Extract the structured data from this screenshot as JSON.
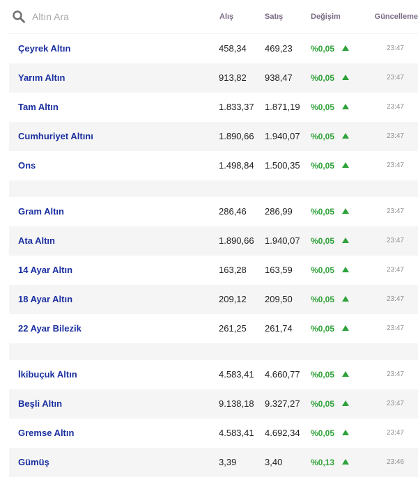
{
  "search": {
    "placeholder": "Altın Ara"
  },
  "columns": {
    "buy": "Alış",
    "sell": "Satış",
    "change": "Değişim",
    "updated": "Güncelleme"
  },
  "colors": {
    "link": "#1a2fa0",
    "up": "#2fa23a",
    "header": "#7b6b84"
  },
  "groups": [
    [
      {
        "name": "Çeyrek Altın",
        "buy": "458,34",
        "sell": "469,23",
        "change": "%0,05",
        "dir": "up",
        "time": "23:47"
      },
      {
        "name": "Yarım Altın",
        "buy": "913,82",
        "sell": "938,47",
        "change": "%0,05",
        "dir": "up",
        "time": "23:47"
      },
      {
        "name": "Tam Altın",
        "buy": "1.833,37",
        "sell": "1.871,19",
        "change": "%0,05",
        "dir": "up",
        "time": "23:47"
      },
      {
        "name": "Cumhuriyet Altını",
        "buy": "1.890,66",
        "sell": "1.940,07",
        "change": "%0,05",
        "dir": "up",
        "time": "23:47"
      },
      {
        "name": "Ons",
        "buy": "1.498,84",
        "sell": "1.500,35",
        "change": "%0,05",
        "dir": "up",
        "time": "23:47"
      }
    ],
    [
      {
        "name": "Gram Altın",
        "buy": "286,46",
        "sell": "286,99",
        "change": "%0,05",
        "dir": "up",
        "time": "23:47"
      },
      {
        "name": "Ata Altın",
        "buy": "1.890,66",
        "sell": "1.940,07",
        "change": "%0,05",
        "dir": "up",
        "time": "23:47"
      },
      {
        "name": "14 Ayar Altın",
        "buy": "163,28",
        "sell": "163,59",
        "change": "%0,05",
        "dir": "up",
        "time": "23:47"
      },
      {
        "name": "18 Ayar Altın",
        "buy": "209,12",
        "sell": "209,50",
        "change": "%0,05",
        "dir": "up",
        "time": "23:47"
      },
      {
        "name": "22 Ayar Bilezik",
        "buy": "261,25",
        "sell": "261,74",
        "change": "%0,05",
        "dir": "up",
        "time": "23:47"
      }
    ],
    [
      {
        "name": "İkibuçuk Altın",
        "buy": "4.583,41",
        "sell": "4.660,77",
        "change": "%0,05",
        "dir": "up",
        "time": "23:47"
      },
      {
        "name": "Beşli Altın",
        "buy": "9.138,18",
        "sell": "9.327,27",
        "change": "%0,05",
        "dir": "up",
        "time": "23:47"
      },
      {
        "name": "Gremse Altın",
        "buy": "4.583,41",
        "sell": "4.692,34",
        "change": "%0,05",
        "dir": "up",
        "time": "23:47"
      },
      {
        "name": "Gümüş",
        "buy": "3,39",
        "sell": "3,40",
        "change": "%0,13",
        "dir": "up",
        "time": "23:46"
      }
    ]
  ]
}
